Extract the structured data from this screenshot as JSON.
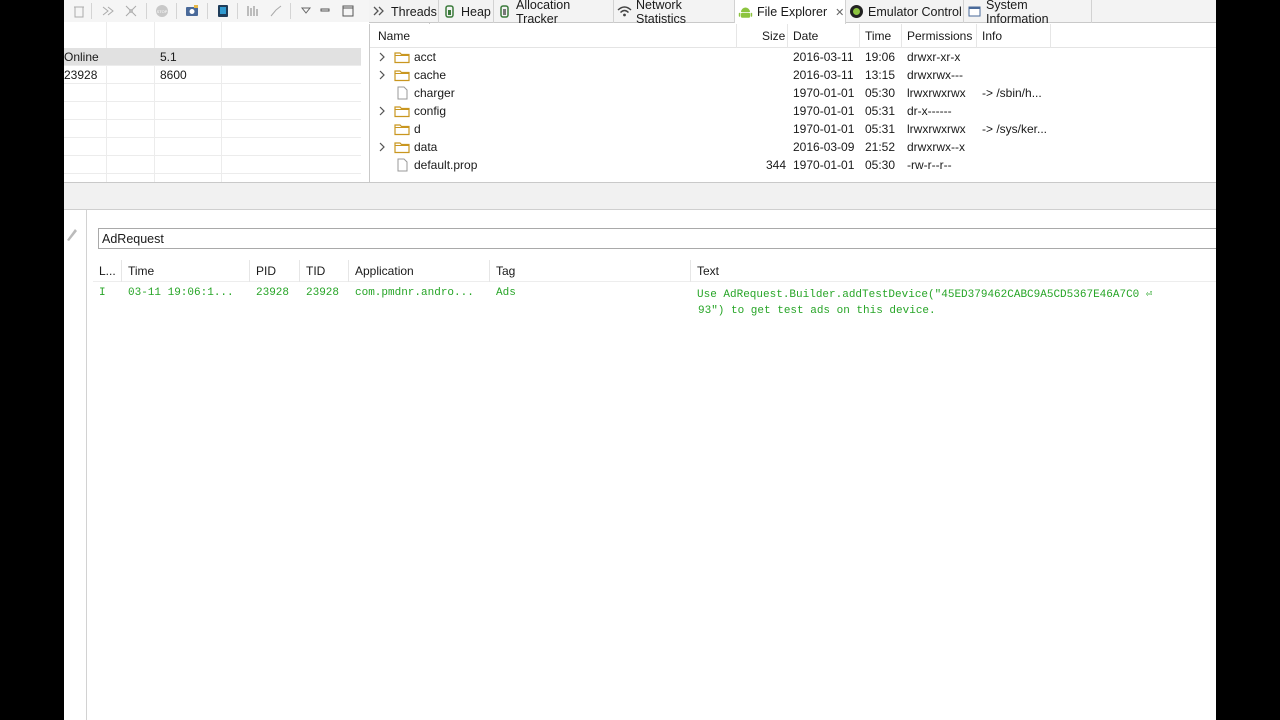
{
  "devices": {
    "rows": [
      {
        "state": "Online",
        "version": "5.1"
      },
      {
        "state": "23928",
        "version": "8600"
      }
    ]
  },
  "tabs": [
    {
      "label": "Threads",
      "icon": "threads-icon"
    },
    {
      "label": "Heap",
      "icon": "heap-icon"
    },
    {
      "label": "Allocation Tracker",
      "icon": "allocation-tracker-icon"
    },
    {
      "label": "Network Statistics",
      "icon": "network-icon"
    },
    {
      "label": "File Explorer",
      "icon": "android-icon",
      "active": true
    },
    {
      "label": "Emulator Control",
      "icon": "emulator-icon"
    },
    {
      "label": "System Information",
      "icon": "system-info-icon"
    }
  ],
  "file_explorer": {
    "columns": {
      "name": "Name",
      "size": "Size",
      "date": "Date",
      "time": "Time",
      "permissions": "Permissions",
      "info": "Info"
    },
    "rows": [
      {
        "name": "acct",
        "size": "",
        "date": "2016-03-11",
        "time": "19:06",
        "permissions": "drwxr-xr-x",
        "info": ""
      },
      {
        "name": "cache",
        "size": "",
        "date": "2016-03-11",
        "time": "13:15",
        "permissions": "drwxrwx---",
        "info": ""
      },
      {
        "name": "charger",
        "size": "",
        "date": "1970-01-01",
        "time": "05:30",
        "permissions": "lrwxrwxrwx",
        "info": "-> /sbin/h..."
      },
      {
        "name": "config",
        "size": "",
        "date": "1970-01-01",
        "time": "05:31",
        "permissions": "dr-x------",
        "info": ""
      },
      {
        "name": "d",
        "size": "",
        "date": "1970-01-01",
        "time": "05:31",
        "permissions": "lrwxrwxrwx",
        "info": "-> /sys/ker..."
      },
      {
        "name": "data",
        "size": "",
        "date": "2016-03-09",
        "time": "21:52",
        "permissions": "drwxrwx--x",
        "info": ""
      },
      {
        "name": "default.prop",
        "size": "344",
        "date": "1970-01-01",
        "time": "05:30",
        "permissions": "-rw-r--r--",
        "info": ""
      }
    ]
  },
  "logcat": {
    "filter_value": "AdRequest",
    "columns": {
      "level": "L...",
      "time": "Time",
      "pid": "PID",
      "tid": "TID",
      "application": "Application",
      "tag": "Tag",
      "text": "Text"
    },
    "rows": [
      {
        "level": "I",
        "time": "03-11 19:06:1...",
        "pid": "23928",
        "tid": "23928",
        "application": "com.pmdnr.andro...",
        "tag": "Ads",
        "text_line1": "Use AdRequest.Builder.addTestDevice(\"45ED379462CABC9A5CD5367E46A7C0 ⏎",
        "text_line2": "93\") to get test ads on this device."
      }
    ]
  },
  "colors": {
    "log_info": "#27a527",
    "folder": "#e8b94a",
    "android": "#8cc43f"
  }
}
